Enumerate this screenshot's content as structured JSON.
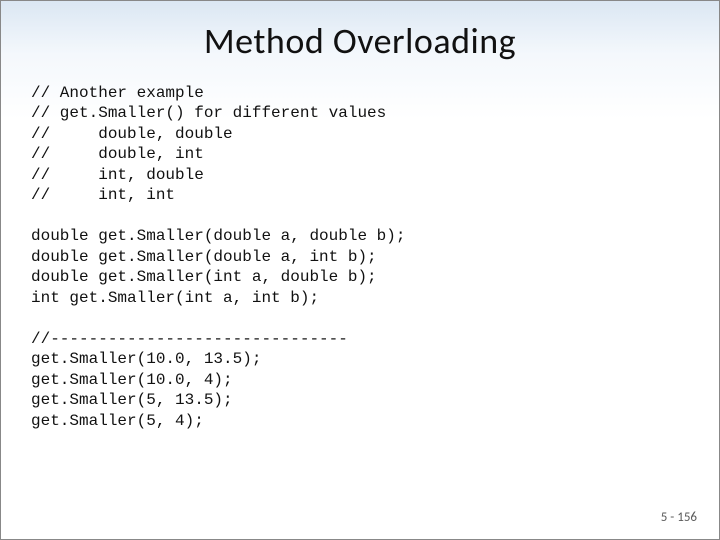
{
  "title": "Method Overloading",
  "code": {
    "c1": "// Another example",
    "c2": "// get.Smaller() for different values",
    "c3": "//     double, double",
    "c4": "//     double, int",
    "c5": "//     int, double",
    "c6": "//     int, int",
    "d1": "double get.Smaller(double a, double b);",
    "d2": "double get.Smaller(double a, int b);",
    "d3": "double get.Smaller(int a, double b);",
    "d4": "int get.Smaller(int a, int b);",
    "s1": "//-------------------------------",
    "s2": "get.Smaller(10.0, 13.5);",
    "s3": "get.Smaller(10.0, 4);",
    "s4": "get.Smaller(5, 13.5);",
    "s5": "get.Smaller(5, 4);"
  },
  "footer": "5 - 156"
}
